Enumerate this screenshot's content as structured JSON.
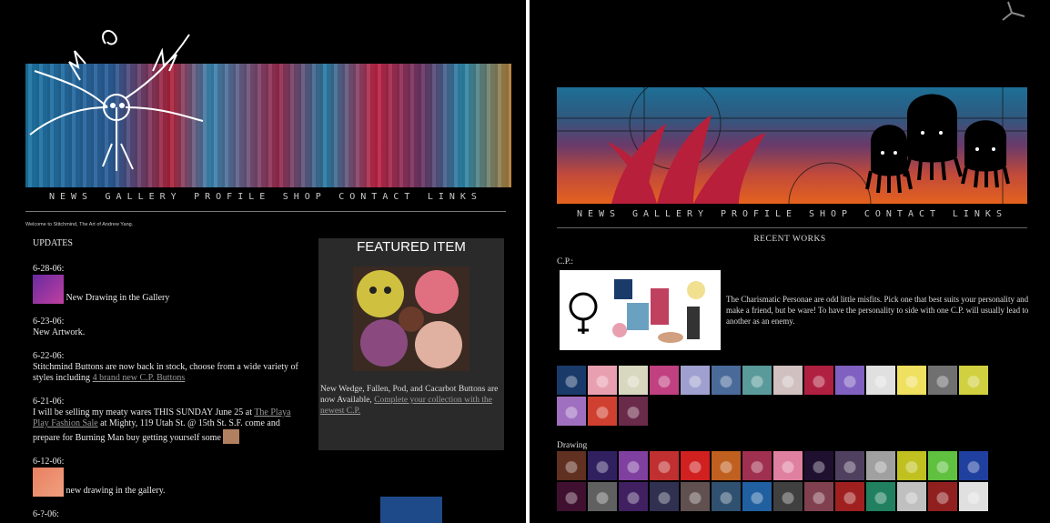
{
  "left_site": {
    "nav": [
      "NEWS",
      "GALLERY",
      "PROFILE",
      "SHOP",
      "CONTACT",
      "LINKS"
    ],
    "welcome": "Welcome to Stitchmind, The Art of Andrew Yang.",
    "updates_heading": "UPDATES",
    "entries": [
      {
        "date": "6-28-06:",
        "text": "New Drawing in the Gallery"
      },
      {
        "date": "6-23-06:",
        "text": "New Artwork."
      },
      {
        "date": "6-22-06:",
        "text": "Stitchmind Buttons are now back in stock, choose from a wide variety of styles including",
        "link": "4 brand new C.P. Buttons"
      },
      {
        "date": "6-21-06:",
        "text_before": "I will be selling my meaty wares THIS SUNDAY June 25 at",
        "link": "The Playa Play Fashion Sale",
        "text_after": "at Mighty, 119 Utah St. @ 15th St. S.F. come and prepare for Burning Man buy getting yourself some"
      },
      {
        "date": "6-12-06:",
        "text": "new drawing in the gallery."
      },
      {
        "date": "6-?-06:",
        "text": ""
      }
    ],
    "featured": {
      "title": "FEATURED ITEM",
      "desc": "New Wedge, Fallen, Pod, and Cacarbot Buttons are now Available,",
      "link": "Complete your collection with the newest C.P."
    }
  },
  "right_site": {
    "nav": [
      "NEWS",
      "GALLERY",
      "PROFILE",
      "SHOP",
      "CONTACT",
      "LINKS"
    ],
    "recent": "RECENT WORKS",
    "cp_label": "C.P.:",
    "cp_text": "The Charismatic Personae are odd little misfits. Pick one that best suits your personality and make a friend, but be ware! To have the personality to side with one C.P. will usually lead to another as an enemy.",
    "drawing_label": "Drawing",
    "cp_thumb_colors": [
      "#1a3a6a",
      "#e8a0b0",
      "#d8d8c0",
      "#c04080",
      "#a0a0d0",
      "#4a6a9a",
      "#5a9a9a",
      "#d0c0c0",
      "#b02040",
      "#8060c0",
      "#e0e0e0",
      "#f0e060",
      "#707070",
      "#d0d040",
      "#a070c0",
      "#d04030",
      "#6a2a4a"
    ],
    "drawing_thumb_colors": [
      "#603020",
      "#302060",
      "#8040a0",
      "#c03030",
      "#d02020",
      "#c06020",
      "#a03050",
      "#e080a0",
      "#201030",
      "#504060",
      "#a0a0a0",
      "#c0c020",
      "#60c040",
      "#2040a0",
      "#401030",
      "#606060",
      "#402060",
      "#303050",
      "#605050",
      "#305070",
      "#2060a0",
      "#404040",
      "#804050",
      "#a02020",
      "#208060",
      "#c0c0c0",
      "#902020",
      "#e0e0e0"
    ]
  },
  "colors": {
    "accent_blue": "#1e78a8",
    "accent_red": "#c22646",
    "banner_orange": "#e4621e"
  }
}
